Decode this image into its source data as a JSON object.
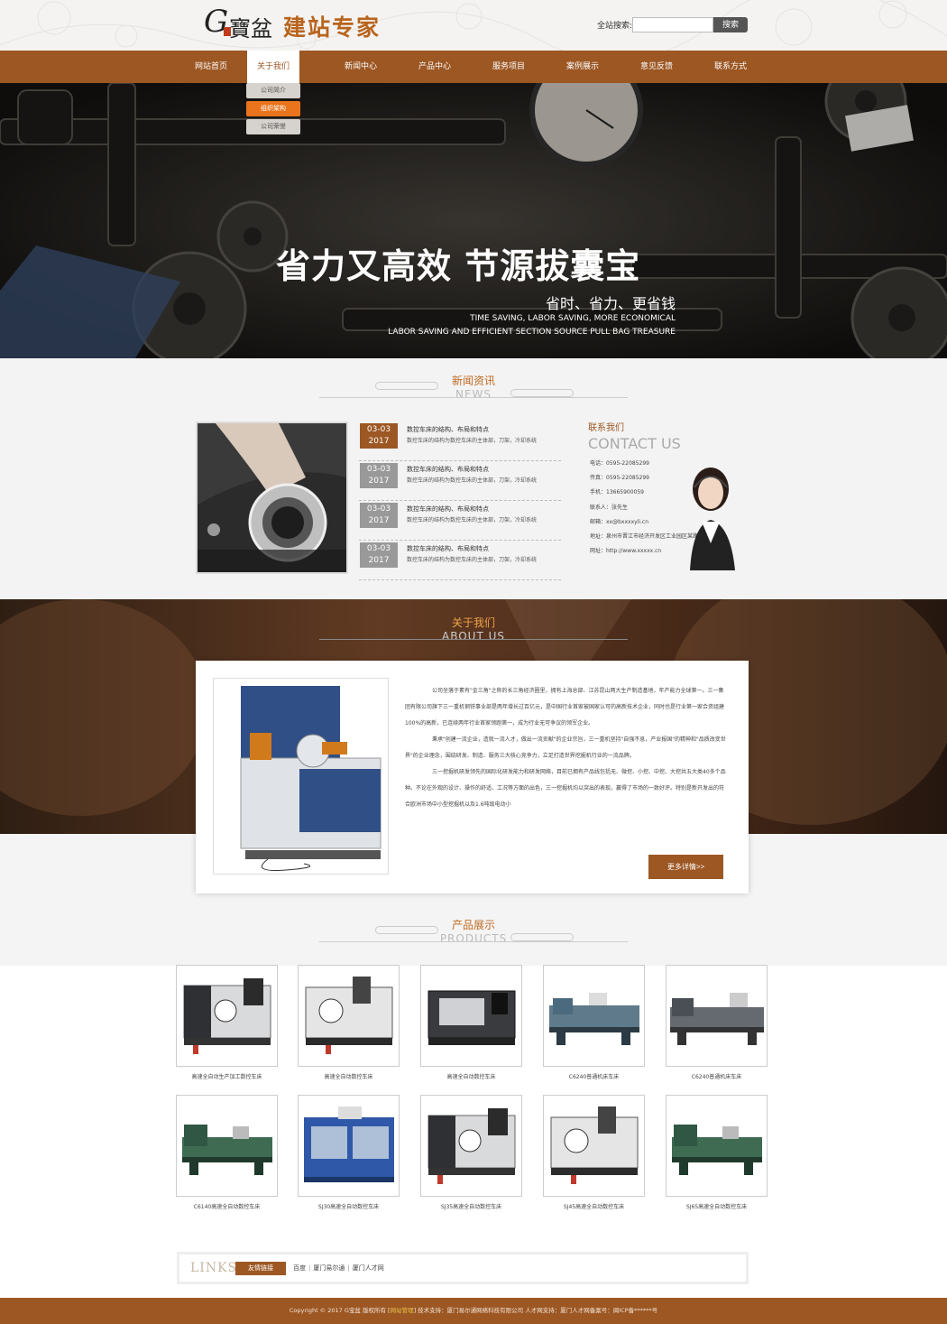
{
  "header": {
    "logo_g": "G",
    "logo_bao": "寶盆",
    "logo_site": "建站专家",
    "search_label": "全站搜索:",
    "search_value": "",
    "search_button": "搜索"
  },
  "nav": {
    "items": [
      {
        "label": "网站首页"
      },
      {
        "label": "关于我们"
      },
      {
        "label": "新闻中心"
      },
      {
        "label": "产品中心"
      },
      {
        "label": "服务项目"
      },
      {
        "label": "案例展示"
      },
      {
        "label": "意见反馈"
      },
      {
        "label": "联系方式"
      }
    ],
    "active_index": 1,
    "submenu": [
      {
        "label": "公司简介"
      },
      {
        "label": "组织架构"
      },
      {
        "label": "公司荣誉"
      }
    ],
    "submenu_active_index": 1
  },
  "banner": {
    "title": "省力又高效 节源拔囊宝",
    "subtitle": "省时、省力、更省钱",
    "en_line1": "TIME SAVING, LABOR SAVING, MORE ECONOMICAL",
    "en_line2": "LABOR SAVING AND EFFICIENT SECTION SOURCE PULL BAG TREASURE"
  },
  "news": {
    "title_cn": "新闻资讯",
    "title_en": "NEWS",
    "items": [
      {
        "date": "03-03",
        "year": "2017",
        "title": "数控车床的结构、布局和特点",
        "desc": "数控车床的结构为数控车床的主体部，刀架，冷却系统"
      },
      {
        "date": "03-03",
        "year": "2017",
        "title": "数控车床的结构、布局和特点",
        "desc": "数控车床的结构为数控车床的主体部，刀架，冷却系统"
      },
      {
        "date": "03-03",
        "year": "2017",
        "title": "数控车床的结构、布局和特点",
        "desc": "数控车床的结构为数控车床的主体部，刀架，冷却系统"
      },
      {
        "date": "03-03",
        "year": "2017",
        "title": "数控车床的结构、布局和特点",
        "desc": "数控车床的结构为数控车床的主体部，刀架，冷却系统"
      }
    ]
  },
  "contact": {
    "title_cn": "联系我们",
    "title_en": "CONTACT US",
    "lines": [
      "电话：0595-22085299",
      "传真：0595-22085299",
      "手机：13665900059",
      "联系人：张先生",
      "邮箱：xx@bxxxxyli.cn",
      "地址：泉州市晋江市经济开发区工业园区某路",
      "网址：http://www.xxxxx.cn"
    ]
  },
  "about": {
    "title_cn": "关于我们",
    "title_en": "ABOUT US",
    "paragraphs": [
      "公司坐落于素有\"金三角\"之称的长三角经济圈里，拥有上海总部、江苏昆山两大生产制造基地，年产能力全球第一。三一集团有限公司旗下三一重机钢铁事业部是两年增长过百亿元，是中国行业首家被国家认可的高新技术企业，同时也是行业第一家合资组建100%的高新，已连续两年行业首家领跑第一，成为行业无可争议的领军企业。",
      "秉承\"创建一流企业，造就一流人才，做出一流贡献\"的企业宗旨，三一重机坚持\"自强不息，产业报国\"的精神和\"品质改变世界\"的企业理念，围绕研发、制造、服务三大核心竞争力，立足打造世界挖掘机行业的一流品牌。",
      "三一挖掘机研发领先的国际化研发能力和研发网络，目前已拥有产品线包括无、微挖、小挖、中挖、大挖共五大类40多个品种。不论在外观的设计、操作的舒适、工况等方面的出色，三一挖掘机均以突出的表现，赢得了市场的一致好评。特别是新开发出的符合欧洲市场中小型挖掘机以及1.6吨级电动小"
    ],
    "more_button": "更多详情>>"
  },
  "products": {
    "title_cn": "产品展示",
    "title_en": "PRODUCTS",
    "items": [
      {
        "name": "高速全自动生产加工数控车床",
        "kind": "cnc-dark"
      },
      {
        "name": "高速全自动数控车床",
        "kind": "cnc-gray"
      },
      {
        "name": "高速全自动数控车床",
        "kind": "cnc-black"
      },
      {
        "name": "C6240普通机床车床",
        "kind": "lathe-small"
      },
      {
        "name": "C6240普通机床车床",
        "kind": "lathe-long"
      },
      {
        "name": "C6140高速全自动数控车床",
        "kind": "lathe-green"
      },
      {
        "name": "SJ30高速全自动数控车床",
        "kind": "laser-blue"
      },
      {
        "name": "SJ35高速全自动数控车床",
        "kind": "cnc-dark"
      },
      {
        "name": "SJ45高速全自动数控车床",
        "kind": "cnc-gray"
      },
      {
        "name": "SJ65高速全自动数控车床",
        "kind": "lathe-green"
      }
    ]
  },
  "links": {
    "label": "LINKS",
    "tag": "友情链接",
    "items": [
      "百度",
      "厦门易尔通",
      "厦门人才网"
    ]
  },
  "footer": {
    "copyright": "Copyright © 2017 G宝盆 版权所有 [",
    "admin": "网站管理",
    "rest": "]   技术支持：厦门易尔通网络科技有限公司 人才网支持：厦门人才网备案号：闽ICP备******号"
  },
  "colors": {
    "accent": "#9c5723",
    "submenu_active": "#e9741c",
    "title_accent": "#c06a22"
  }
}
